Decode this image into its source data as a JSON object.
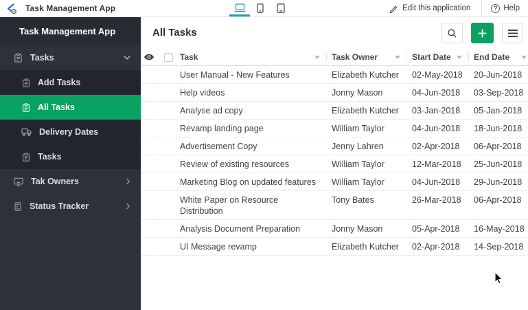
{
  "topbar": {
    "app_name": "Task Management App",
    "edit_label": "Edit this application",
    "help_label": "Help",
    "help_glyph": "?"
  },
  "sidebar": {
    "title": "Task Management App",
    "items": [
      {
        "label": "Tasks"
      },
      {
        "label": "Add Tasks"
      },
      {
        "label": "All Tasks"
      },
      {
        "label": "Delivery Dates"
      },
      {
        "label": "Tasks"
      },
      {
        "label": "Tak Owners"
      },
      {
        "label": "Status Tracker"
      }
    ]
  },
  "main": {
    "title": "All Tasks",
    "table": {
      "columns": [
        "Task",
        "Task Owner",
        "Start Date",
        "End Date"
      ],
      "rows": [
        {
          "task": "User Manual - New Features",
          "owner": "Elizabeth Kutcher",
          "start": "02-May-2018",
          "end": "20-Jun-2018"
        },
        {
          "task": "Help videos",
          "owner": "Jonny Mason",
          "start": "04-Jun-2018",
          "end": "03-Sep-2018"
        },
        {
          "task": "Analyse ad copy",
          "owner": "Elizabeth Kutcher",
          "start": "03-Jan-2018",
          "end": "05-Jan-2018"
        },
        {
          "task": "Revamp landing page",
          "owner": "William Taylor",
          "start": "04-Jun-2018",
          "end": "18-Jun-2018"
        },
        {
          "task": "Advertisement Copy",
          "owner": "Jenny Lahren",
          "start": "02-Apr-2018",
          "end": "06-Apr-2018"
        },
        {
          "task": "Review of existing resources",
          "owner": "William Taylor",
          "start": "12-Mar-2018",
          "end": "25-Jun-2018"
        },
        {
          "task": "Marketing Blog on updated features",
          "owner": "William Taylor",
          "start": "04-Jun-2018",
          "end": "29-Jun-2018"
        },
        {
          "task": "White Paper on Resource Distribution",
          "owner": "Tony Bates",
          "start": "26-Mar-2018",
          "end": "06-Apr-2018"
        },
        {
          "task": "Analysis Document Preparation",
          "owner": "Jonny Mason",
          "start": "05-Apr-2018",
          "end": "16-May-2018"
        },
        {
          "task": "UI Message revamp",
          "owner": "Elizabeth Kutcher",
          "start": "02-Apr-2018",
          "end": "14-Sep-2018"
        }
      ]
    }
  },
  "icons": {
    "logo": "creator-logo",
    "devices": [
      "laptop",
      "phone",
      "tablet"
    ],
    "edit": "pencil",
    "help": "question-circle",
    "actions": [
      "search",
      "plus",
      "hamburger"
    ],
    "table_header": [
      "eye",
      "checkbox",
      "sort-triangle"
    ],
    "sidebar": [
      "clipboard",
      "truck",
      "monitor",
      "tracker",
      "chevron-down",
      "chevron-right"
    ]
  },
  "colors": {
    "accent_green": "#09a263",
    "device_active_blue": "#2196d4",
    "sidebar_bg": "#2e303a",
    "sidebar_sub_bg": "#23252e",
    "sidebar_header_bg": "#292b34"
  }
}
